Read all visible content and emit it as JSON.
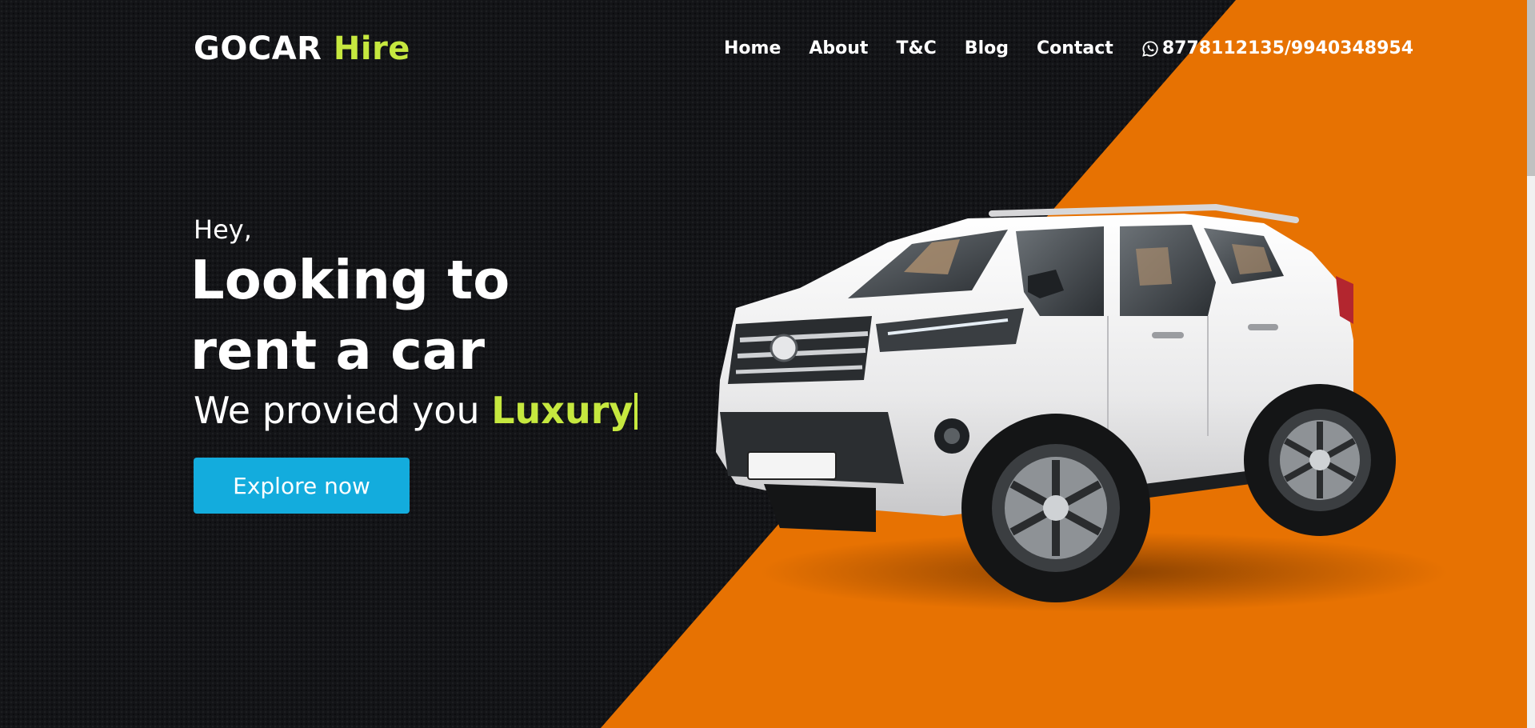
{
  "brand": {
    "name": "GOCAR",
    "accent": "Hire",
    "accent_color": "#c6e83f"
  },
  "nav": {
    "items": [
      {
        "label": "Home"
      },
      {
        "label": "About"
      },
      {
        "label": "T&C"
      },
      {
        "label": "Blog"
      },
      {
        "label": "Contact"
      }
    ],
    "phone": {
      "icon": "whatsapp-icon",
      "text": "8778112135/9940348954"
    }
  },
  "hero": {
    "greeting": "Hey,",
    "title_line1": "Looking to",
    "title_line2": "rent a car",
    "subtitle": "We provied you",
    "subtitle_accent": "Luxury",
    "cta_label": "Explore now"
  },
  "colors": {
    "background": "#131417",
    "orange": "#e77202",
    "cta": "#13acdd",
    "accent": "#c6e83f"
  }
}
